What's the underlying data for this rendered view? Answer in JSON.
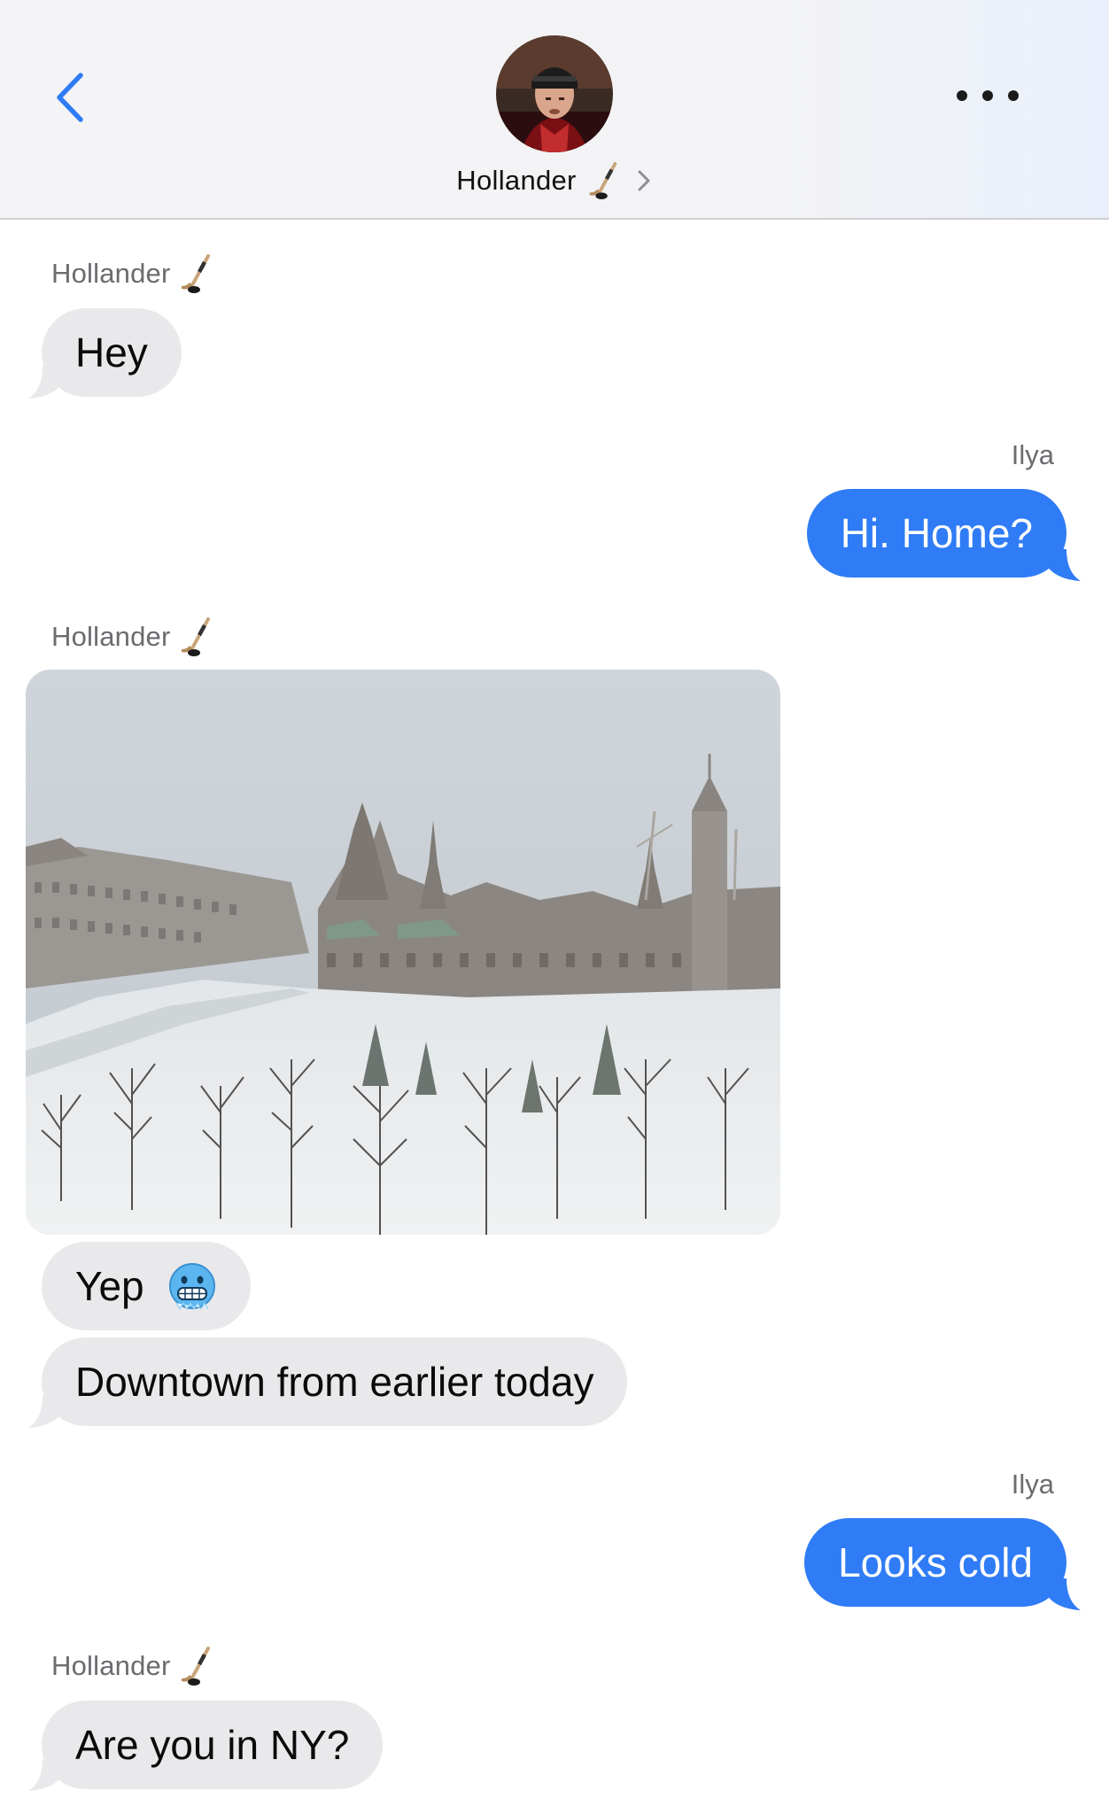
{
  "header": {
    "contact_name": "Hollander",
    "back_icon": "chevron-left-icon",
    "more_icon": "ellipsis-icon",
    "name_emoji": "hockey-stick-icon",
    "accent": "#2f7cf6"
  },
  "messages": [
    {
      "sender": "Hollander",
      "direction": "incoming",
      "text": "Hey"
    },
    {
      "sender": "Ilya",
      "direction": "outgoing",
      "text": "Hi. Home?"
    },
    {
      "sender": "Hollander",
      "direction": "incoming",
      "type": "photo",
      "alt_icon": "snowy-parliament-photo"
    },
    {
      "sender": "Hollander",
      "direction": "incoming",
      "text": "Yep",
      "emoji": "cold-face-icon"
    },
    {
      "sender": "Hollander",
      "direction": "incoming",
      "text": "Downtown from earlier today"
    },
    {
      "sender": "Ilya",
      "direction": "outgoing",
      "text": "Looks cold"
    },
    {
      "sender": "Hollander",
      "direction": "incoming",
      "text": "Are you in NY?"
    }
  ],
  "colors": {
    "incoming_bubble": "#e9e9eb",
    "outgoing_bubble": "#2f7cf6",
    "label_gray": "#6b6b70"
  }
}
